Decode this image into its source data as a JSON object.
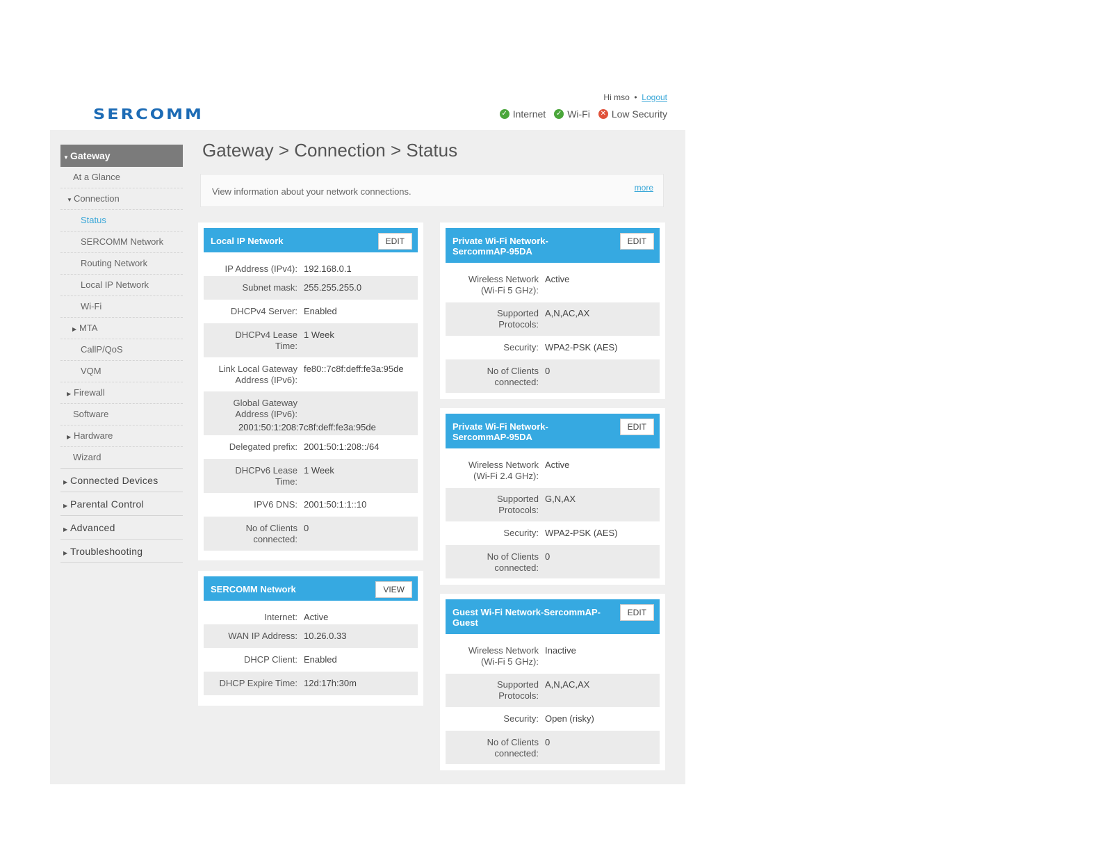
{
  "header": {
    "logo": "SERCOMM",
    "greeting": "Hi mso",
    "separator": "•",
    "logout": "Logout",
    "status": [
      {
        "label": "Internet",
        "icon": "check-circle-icon",
        "state": "ok"
      },
      {
        "label": "Wi-Fi",
        "icon": "check-circle-icon",
        "state": "ok"
      },
      {
        "label": "Low Security",
        "icon": "x-circle-icon",
        "state": "bad"
      }
    ]
  },
  "sidebar": {
    "top": "Gateway",
    "items": [
      {
        "label": "At a Glance"
      },
      {
        "label": "Connection"
      },
      {
        "label": "Status"
      },
      {
        "label": "SERCOMM Network"
      },
      {
        "label": "Routing Network"
      },
      {
        "label": "Local IP Network"
      },
      {
        "label": "Wi-Fi"
      },
      {
        "label": "MTA"
      },
      {
        "label": "CallP/QoS"
      },
      {
        "label": "VQM"
      },
      {
        "label": "Firewall"
      },
      {
        "label": "Software"
      },
      {
        "label": "Hardware"
      },
      {
        "label": "Wizard"
      }
    ],
    "main": [
      {
        "label": "Connected Devices"
      },
      {
        "label": "Parental Control"
      },
      {
        "label": "Advanced"
      },
      {
        "label": "Troubleshooting"
      }
    ]
  },
  "page": {
    "title": "Gateway > Connection > Status",
    "info": "View information about your network connections.",
    "more": "more"
  },
  "cards": {
    "local_ip": {
      "title": "Local IP Network",
      "button": "EDIT",
      "rows": [
        {
          "label": "IP Address (IPv4):",
          "value": "192.168.0.1"
        },
        {
          "label": "Subnet mask:",
          "value": "255.255.255.0"
        },
        {
          "label": "DHCPv4 Server:",
          "value": "Enabled"
        },
        {
          "label": "DHCPv4 Lease Time:",
          "value": "1 Week"
        },
        {
          "label": "Link Local Gateway Address (IPv6):",
          "value": "fe80::7c8f:deff:fe3a:95de"
        },
        {
          "label": "Global Gateway Address (IPv6):",
          "value": "2001:50:1:208:7c8f:deff:fe3a:95de"
        },
        {
          "label": "Delegated prefix:",
          "value": "2001:50:1:208::/64"
        },
        {
          "label": "DHCPv6 Lease Time:",
          "value": "1 Week"
        },
        {
          "label": "IPV6 DNS:",
          "value": "2001:50:1:1::10"
        },
        {
          "label": "No of Clients connected:",
          "value": "0"
        }
      ]
    },
    "sercomm": {
      "title": "SERCOMM Network",
      "button": "VIEW",
      "rows": [
        {
          "label": "Internet:",
          "value": "Active"
        },
        {
          "label": "WAN IP Address:",
          "value": "10.26.0.33"
        },
        {
          "label": "DHCP Client:",
          "value": "Enabled"
        },
        {
          "label": "DHCP Expire Time:",
          "value": "12d:17h:30m"
        }
      ]
    },
    "wifi5": {
      "title": "Private Wi-Fi Network-SercommAP-95DA",
      "button": "EDIT",
      "rows": [
        {
          "label": "Wireless Network (Wi-Fi 5 GHz):",
          "value": "Active"
        },
        {
          "label": "Supported Protocols:",
          "value": "A,N,AC,AX"
        },
        {
          "label": "Security:",
          "value": "WPA2-PSK (AES)"
        },
        {
          "label": "No of Clients connected:",
          "value": "0"
        }
      ]
    },
    "wifi24": {
      "title": "Private Wi-Fi Network-SercommAP-95DA",
      "button": "EDIT",
      "rows": [
        {
          "label": "Wireless Network (Wi-Fi 2.4 GHz):",
          "value": "Active"
        },
        {
          "label": "Supported Protocols:",
          "value": "G,N,AX"
        },
        {
          "label": "Security:",
          "value": "WPA2-PSK (AES)"
        },
        {
          "label": "No of Clients connected:",
          "value": "0"
        }
      ]
    },
    "guest": {
      "title": "Guest Wi-Fi Network-SercommAP-Guest",
      "button": "EDIT",
      "rows": [
        {
          "label": "Wireless Network (Wi-Fi 5 GHz):",
          "value": "Inactive"
        },
        {
          "label": "Supported Protocols:",
          "value": "A,N,AC,AX"
        },
        {
          "label": "Security:",
          "value": "Open (risky)"
        },
        {
          "label": "No of Clients connected:",
          "value": "0"
        }
      ]
    }
  },
  "colors": {
    "accent": "#36a9e1",
    "brand": "#1c6bb5",
    "ok": "#4aa63a",
    "bad": "#e0523a",
    "nav_active_bg": "#7b7b7b"
  }
}
